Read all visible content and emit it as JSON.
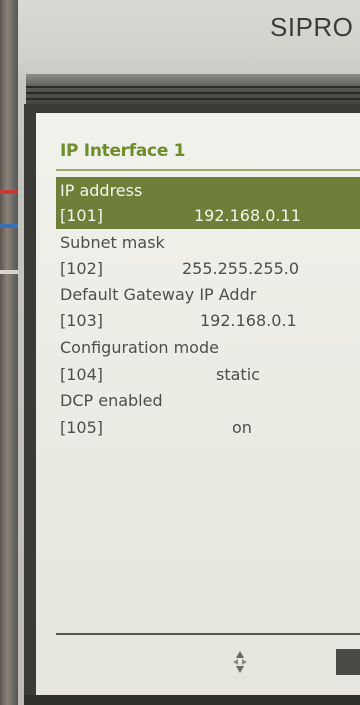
{
  "device": {
    "brand": "SIPRO"
  },
  "screen": {
    "title": "IP Interface 1",
    "parameters": [
      {
        "name": "IP address",
        "id": "[101]",
        "value": "192.168.0.11",
        "selected": true
      },
      {
        "name": "Subnet mask",
        "id": "[102]",
        "value": "255.255.255.0",
        "selected": false
      },
      {
        "name": "Default Gateway IP Addr",
        "id": "[103]",
        "value": "192.168.0.1",
        "selected": false
      },
      {
        "name": "Configuration mode",
        "id": "[104]",
        "value": "static",
        "selected": false
      },
      {
        "name": "DCP enabled",
        "id": "[105]",
        "value": "on",
        "selected": false
      }
    ]
  },
  "footer": {
    "nav_icon": "up-down-arrows-icon",
    "softkey_icon": "softkey-icon"
  },
  "colors": {
    "title": "#6f8d2c",
    "selection_background": "#6f7f3a",
    "screen_background": "#ecece5",
    "text": "#4f4f4a"
  }
}
